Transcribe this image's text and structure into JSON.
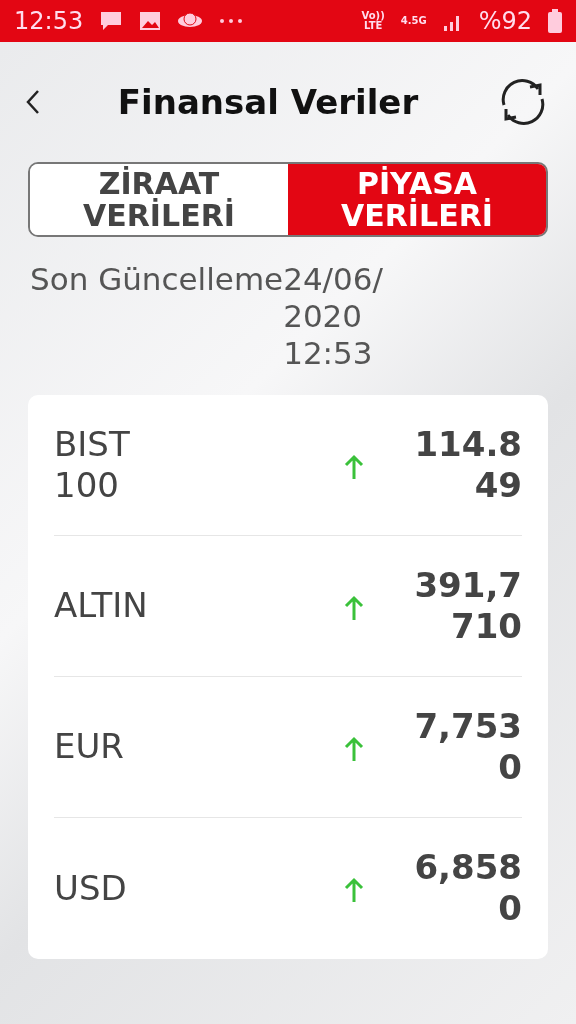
{
  "status_bar": {
    "time": "12:53",
    "volte": "Vo))",
    "lte": "LTE",
    "network": "4.5G",
    "battery": "%92"
  },
  "header": {
    "title": "Finansal Veriler"
  },
  "tabs": [
    {
      "label": "ZİRAAT VERİLERİ",
      "selected": false
    },
    {
      "label": "PİYASA VERİLERİ",
      "selected": true
    }
  ],
  "last_update": {
    "label": "Son Güncelleme",
    "value": "24/06/2020 12:53"
  },
  "rates": [
    {
      "name": "BIST 100",
      "rising": true,
      "value": "114.849"
    },
    {
      "name": "ALTIN",
      "rising": true,
      "value": "391,7710"
    },
    {
      "name": "EUR",
      "rising": true,
      "value": "7,7530"
    },
    {
      "name": "USD",
      "rising": true,
      "value": "6,8580"
    }
  ]
}
